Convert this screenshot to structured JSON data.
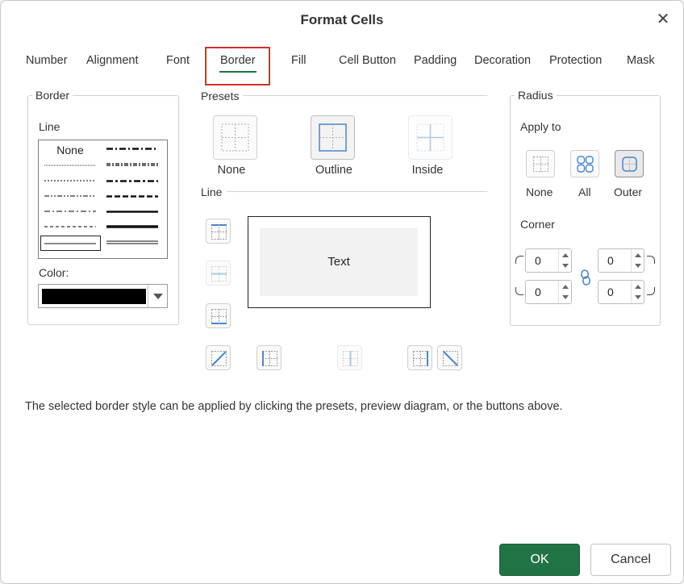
{
  "dialog": {
    "title": "Format Cells",
    "close_glyph": "✕"
  },
  "tabs": [
    {
      "label": "Number",
      "active": false
    },
    {
      "label": "Alignment",
      "active": false
    },
    {
      "label": "Font",
      "active": false
    },
    {
      "label": "Border",
      "active": true
    },
    {
      "label": "Fill",
      "active": false
    },
    {
      "label": "Cell Button",
      "active": false
    },
    {
      "label": "Padding",
      "active": false
    },
    {
      "label": "Decoration",
      "active": false
    },
    {
      "label": "Protection",
      "active": false
    },
    {
      "label": "Mask",
      "active": false
    }
  ],
  "border_group": {
    "title": "Border",
    "line_label": "Line",
    "none_label": "None",
    "color_label": "Color:",
    "color_value": "#000000"
  },
  "presets": {
    "title": "Presets",
    "items": [
      {
        "label": "None",
        "icon": "preset-none-icon"
      },
      {
        "label": "Outline",
        "icon": "preset-outline-icon"
      },
      {
        "label": "Inside",
        "icon": "preset-inside-icon"
      }
    ],
    "line_title": "Line"
  },
  "preview": {
    "text": "Text"
  },
  "radius": {
    "title": "Radius",
    "apply_to_label": "Apply to",
    "apply_options": [
      {
        "label": "None"
      },
      {
        "label": "All"
      },
      {
        "label": "Outer"
      }
    ],
    "selected": "Outer",
    "corner_label": "Corner",
    "corners": {
      "top_left": "0",
      "top_right": "0",
      "bottom_left": "0",
      "bottom_right": "0"
    }
  },
  "footnote": "The selected border style can be applied by clicking the presets, preview diagram, or the buttons above.",
  "buttons": {
    "ok": "OK",
    "cancel": "Cancel"
  },
  "colors": {
    "accent": "#217346",
    "highlight": "#d32f2f",
    "icon_blue": "#4a86c8"
  }
}
